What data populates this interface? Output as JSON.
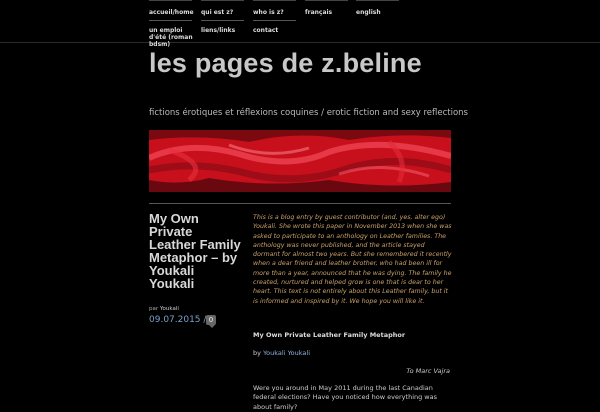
{
  "nav": {
    "items": [
      {
        "label": "accueil/home"
      },
      {
        "label": "qui est z?"
      },
      {
        "label": "who is z?"
      },
      {
        "label": "français"
      },
      {
        "label": "english"
      },
      {
        "label": "un emploi d'été (roman bdsm)"
      },
      {
        "label": "liens/links"
      },
      {
        "label": "contact"
      }
    ]
  },
  "site": {
    "title": "les pages de z.beline",
    "tagline": "fictions érotiques et réflexions coquines / erotic fiction and sexy reflections"
  },
  "post": {
    "title": "My Own Private Leather Family Metaphor – by Youkali Youkali",
    "by_prefix": "par",
    "author": "Youkali",
    "date": "09.07.2015",
    "date_sep": "//",
    "comments": "0",
    "intro": "This is a blog entry by guest contributor (and, yes, alter ego) Youkali. She wrote this paper in November 2013 when she was asked to participate to an anthology on Leather families. The anthology was never published, and the article stayed dormant for almost two years. But she remembered it recently when a dear friend and leather brother, who had been ill for more than a year, announced that he was dying. The family he created, nurtured and helped grow is one that is dear to her heart. This text is not entirely about this Leather family, but it is informed and inspired by it. We hope you will like it.",
    "heading": "My Own Private Leather Family Metaphor",
    "by_label": "by",
    "by_author": "Youkali Youkali",
    "dedication": "To Marc Vajra",
    "body": "Were you around in May 2011 during the last Canadian federal elections? Have you noticed how everything was about family?"
  }
}
